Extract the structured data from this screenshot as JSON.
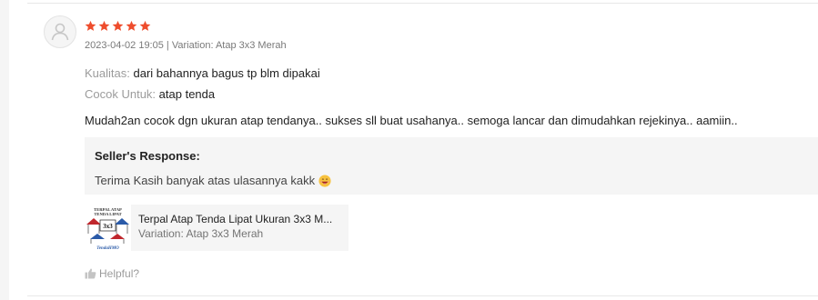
{
  "review": {
    "rating": 5,
    "timestamp": "2023-04-02 19:05",
    "separator": " | ",
    "variation_label": "Variation: ",
    "variation_value": "Atap 3x3 Merah",
    "attributes": [
      {
        "label": "Kualitas:",
        "value": "dari bahannya bagus tp blm dipakai"
      },
      {
        "label": "Cocok Untuk:",
        "value": "atap tenda"
      }
    ],
    "comment": "Mudah2an cocok dgn ukuran atap tendanya.. sukses sll buat usahanya.. semoga lancar dan dimudahkan rejekinya.. aamiin..",
    "seller_response": {
      "title": "Seller's Response:",
      "text": "Terima Kasih banyak atas ulasannya kakk"
    },
    "product": {
      "name": "Terpal Atap Tenda Lipat Ukuran 3x3 M...",
      "variation": "Variation: Atap 3x3 Merah",
      "thumb_texts": [
        "TERPAL ATAP",
        "TENDA LIPAT",
        "3x3",
        "TendaHMO"
      ]
    },
    "helpful_label": "Helpful?"
  },
  "colors": {
    "star": "#ee4d2d",
    "tent_red": "#c0272d",
    "tent_blue": "#2a5aa8"
  },
  "icons": {
    "avatar": "user-icon",
    "star": "star-icon",
    "emoji": "smile-emoji-icon",
    "helpful": "thumbs-up-icon"
  }
}
